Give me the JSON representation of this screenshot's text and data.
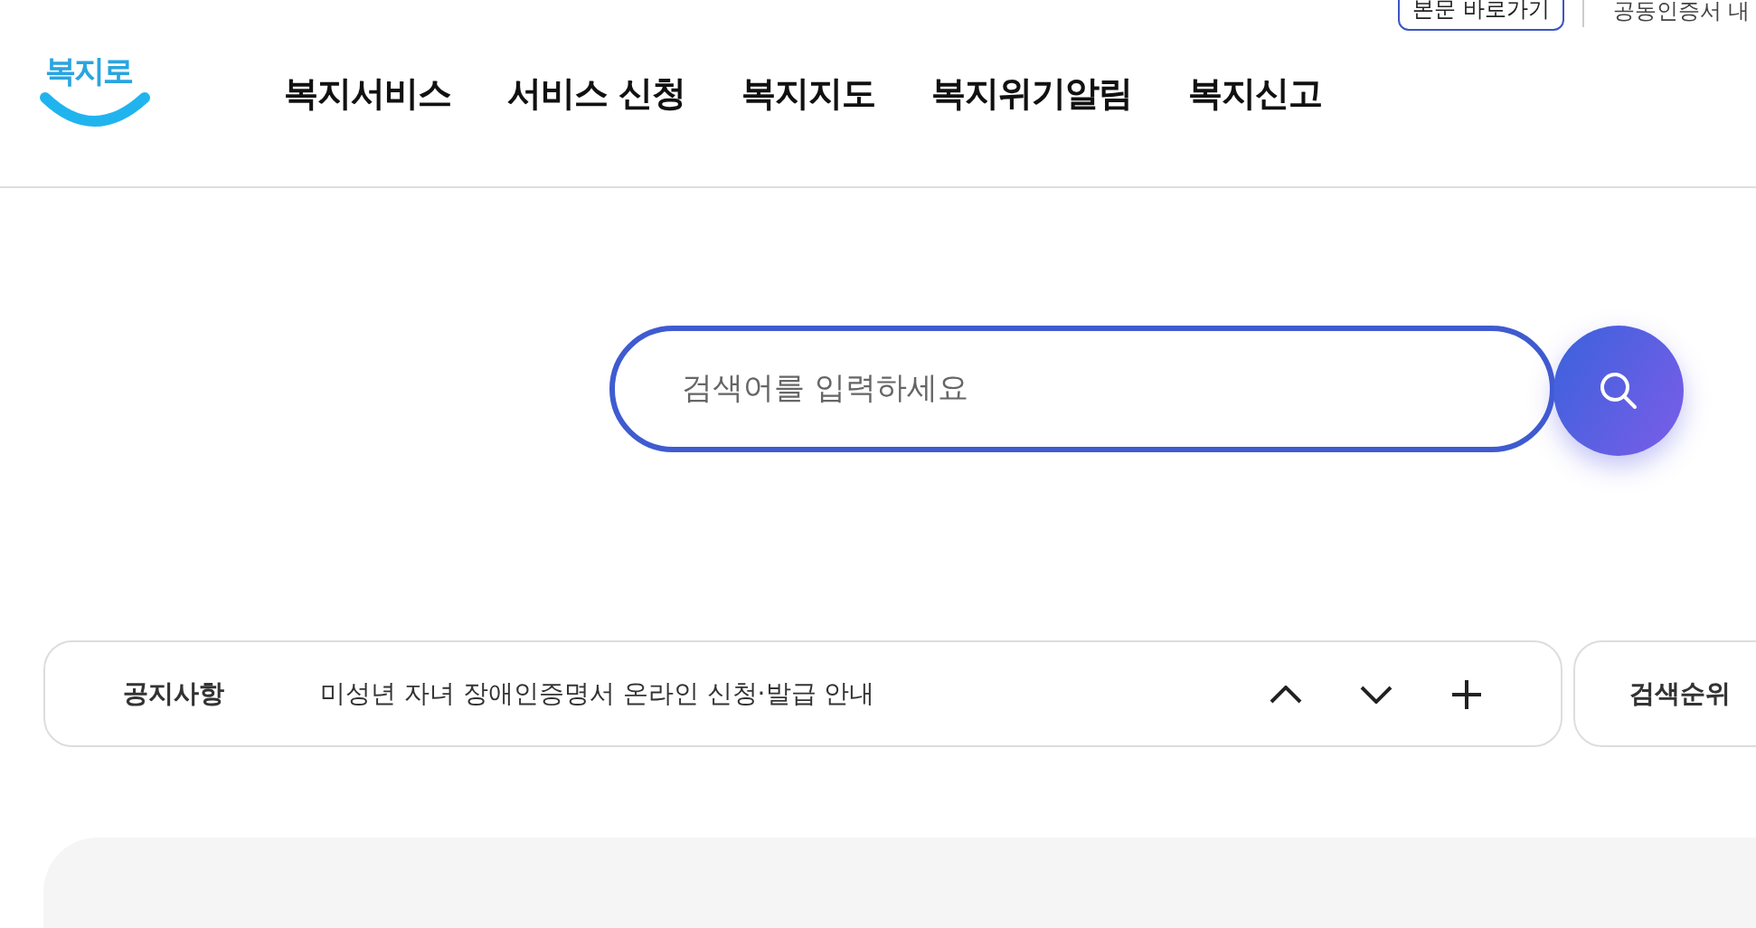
{
  "utility_links": [
    {
      "label": "본문 바로가기",
      "kind": "outlined"
    },
    {
      "label": "공동인증서 내",
      "kind": "plain"
    }
  ],
  "logo": {
    "text": "복지로"
  },
  "nav": [
    "복지서비스",
    "서비스 신청",
    "복지지도",
    "복지위기알림",
    "복지신고"
  ],
  "search": {
    "placeholder": "검색어를 입력하세요"
  },
  "notice": {
    "label": "공지사항",
    "text": "미성년 자녀 장애인증명서 온라인 신청·발급 안내"
  },
  "ranking": {
    "label": "검색순위"
  }
}
